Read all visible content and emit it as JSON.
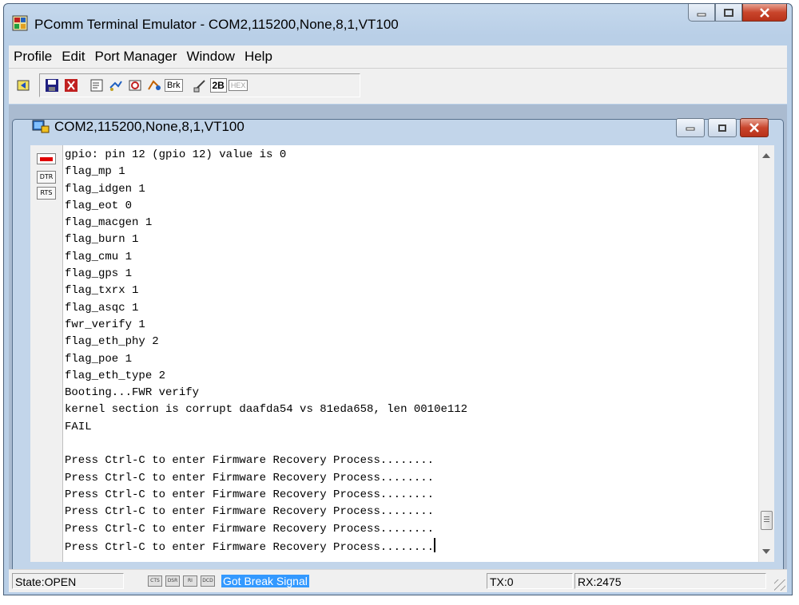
{
  "window": {
    "title": "PComm Terminal Emulator - COM2,115200,None,8,1,VT100"
  },
  "menu": [
    "Profile",
    "Edit",
    "Port Manager",
    "Window",
    "Help"
  ],
  "toolbar": {
    "brk_label": "Brk",
    "twob_label": "2B",
    "hex_label": "HEX"
  },
  "child": {
    "title": "COM2,115200,None,8,1,VT100"
  },
  "signals": {
    "dtr": "DTR",
    "rts": "RTS"
  },
  "terminal": {
    "lines": [
      "gpio: pin 12 (gpio 12) value is 0",
      "flag_mp 1",
      "flag_idgen 1",
      "flag_eot 0",
      "flag_macgen 1",
      "flag_burn 1",
      "flag_cmu 1",
      "flag_gps 1",
      "flag_txrx 1",
      "flag_asqc 1",
      "fwr_verify 1",
      "flag_eth_phy 2",
      "flag_poe 1",
      "flag_eth_type 2",
      "Booting...FWR verify",
      "kernel section is corrupt daafda54 vs 81eda658, len 0010e112",
      "FAIL",
      "",
      "Press Ctrl-C to enter Firmware Recovery Process........",
      "Press Ctrl-C to enter Firmware Recovery Process........",
      "Press Ctrl-C to enter Firmware Recovery Process........",
      "Press Ctrl-C to enter Firmware Recovery Process........",
      "Press Ctrl-C to enter Firmware Recovery Process........",
      "Press Ctrl-C to enter Firmware Recovery Process........"
    ]
  },
  "status": {
    "state": "State:OPEN",
    "leds": [
      "CTS",
      "DSR",
      "RI",
      "DCD"
    ],
    "message": "Got Break Signal",
    "tx": "TX:0",
    "rx": "RX:2475"
  }
}
